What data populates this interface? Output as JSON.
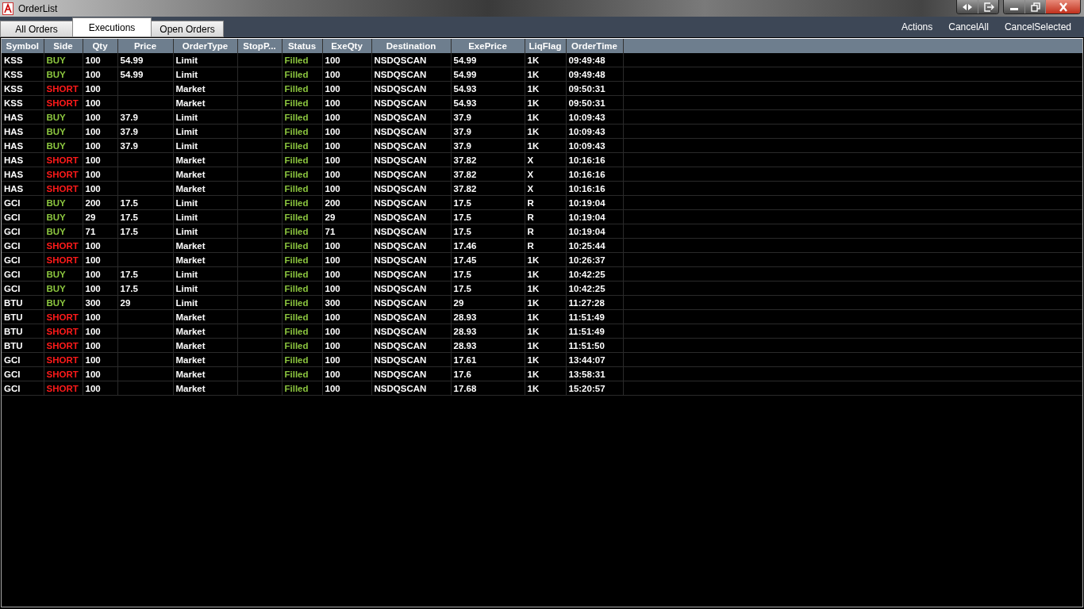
{
  "window": {
    "title": "OrderList"
  },
  "tabs": [
    {
      "label": "All Orders",
      "selected": false
    },
    {
      "label": "Executions",
      "selected": true
    },
    {
      "label": "Open Orders",
      "selected": false
    }
  ],
  "actions": [
    "Actions",
    "CancelAll",
    "CancelSelected"
  ],
  "table": {
    "columns": [
      "Symbol",
      "Side",
      "Qty",
      "Price",
      "OrderType",
      "StopP...",
      "Status",
      "ExeQty",
      "Destination",
      "ExePrice",
      "LiqFlag",
      "OrderTime"
    ],
    "rows": [
      {
        "symbol": "KSS",
        "side": {
          "text": "BUY",
          "color": "#8cc63f"
        },
        "qty": "100",
        "price": "54.99",
        "order_type": "Limit",
        "status": {
          "text": "Filled",
          "color": "#8cc63f"
        },
        "exe_qty": "100",
        "destination": "NSDQSCAN",
        "exe_price": "54.99",
        "liq_flag": "1K",
        "order_time": "09:49:48"
      },
      {
        "symbol": "KSS",
        "side": {
          "text": "BUY",
          "color": "#8cc63f"
        },
        "qty": "100",
        "price": "54.99",
        "order_type": "Limit",
        "status": {
          "text": "Filled",
          "color": "#8cc63f"
        },
        "exe_qty": "100",
        "destination": "NSDQSCAN",
        "exe_price": "54.99",
        "liq_flag": "1K",
        "order_time": "09:49:48"
      },
      {
        "symbol": "KSS",
        "side": {
          "text": "SHORT",
          "color": "#ff1a1a"
        },
        "qty": "100",
        "order_type": "Market",
        "status": {
          "text": "Filled",
          "color": "#8cc63f"
        },
        "exe_qty": "100",
        "destination": "NSDQSCAN",
        "exe_price": "54.93",
        "liq_flag": "1K",
        "order_time": "09:50:31"
      },
      {
        "symbol": "KSS",
        "side": {
          "text": "SHORT",
          "color": "#ff1a1a"
        },
        "qty": "100",
        "order_type": "Market",
        "status": {
          "text": "Filled",
          "color": "#8cc63f"
        },
        "exe_qty": "100",
        "destination": "NSDQSCAN",
        "exe_price": "54.93",
        "liq_flag": "1K",
        "order_time": "09:50:31"
      },
      {
        "symbol": "HAS",
        "side": {
          "text": "BUY",
          "color": "#8cc63f"
        },
        "qty": "100",
        "price": "37.9",
        "order_type": "Limit",
        "status": {
          "text": "Filled",
          "color": "#8cc63f"
        },
        "exe_qty": "100",
        "destination": "NSDQSCAN",
        "exe_price": "37.9",
        "liq_flag": "1K",
        "order_time": "10:09:43"
      },
      {
        "symbol": "HAS",
        "side": {
          "text": "BUY",
          "color": "#8cc63f"
        },
        "qty": "100",
        "price": "37.9",
        "order_type": "Limit",
        "status": {
          "text": "Filled",
          "color": "#8cc63f"
        },
        "exe_qty": "100",
        "destination": "NSDQSCAN",
        "exe_price": "37.9",
        "liq_flag": "1K",
        "order_time": "10:09:43"
      },
      {
        "symbol": "HAS",
        "side": {
          "text": "BUY",
          "color": "#8cc63f"
        },
        "qty": "100",
        "price": "37.9",
        "order_type": "Limit",
        "status": {
          "text": "Filled",
          "color": "#8cc63f"
        },
        "exe_qty": "100",
        "destination": "NSDQSCAN",
        "exe_price": "37.9",
        "liq_flag": "1K",
        "order_time": "10:09:43"
      },
      {
        "symbol": "HAS",
        "side": {
          "text": "SHORT",
          "color": "#ff1a1a"
        },
        "qty": "100",
        "order_type": "Market",
        "status": {
          "text": "Filled",
          "color": "#8cc63f"
        },
        "exe_qty": "100",
        "destination": "NSDQSCAN",
        "exe_price": "37.82",
        "liq_flag": "X",
        "order_time": "10:16:16"
      },
      {
        "symbol": "HAS",
        "side": {
          "text": "SHORT",
          "color": "#ff1a1a"
        },
        "qty": "100",
        "order_type": "Market",
        "status": {
          "text": "Filled",
          "color": "#8cc63f"
        },
        "exe_qty": "100",
        "destination": "NSDQSCAN",
        "exe_price": "37.82",
        "liq_flag": "X",
        "order_time": "10:16:16"
      },
      {
        "symbol": "HAS",
        "side": {
          "text": "SHORT",
          "color": "#ff1a1a"
        },
        "qty": "100",
        "order_type": "Market",
        "status": {
          "text": "Filled",
          "color": "#8cc63f"
        },
        "exe_qty": "100",
        "destination": "NSDQSCAN",
        "exe_price": "37.82",
        "liq_flag": "X",
        "order_time": "10:16:16"
      },
      {
        "symbol": "GCI",
        "side": {
          "text": "BUY",
          "color": "#8cc63f"
        },
        "qty": "200",
        "price": "17.5",
        "order_type": "Limit",
        "status": {
          "text": "Filled",
          "color": "#8cc63f"
        },
        "exe_qty": "200",
        "destination": "NSDQSCAN",
        "exe_price": "17.5",
        "liq_flag": "R",
        "order_time": "10:19:04"
      },
      {
        "symbol": "GCI",
        "side": {
          "text": "BUY",
          "color": "#8cc63f"
        },
        "qty": "29",
        "price": "17.5",
        "order_type": "Limit",
        "status": {
          "text": "Filled",
          "color": "#8cc63f"
        },
        "exe_qty": "29",
        "destination": "NSDQSCAN",
        "exe_price": "17.5",
        "liq_flag": "R",
        "order_time": "10:19:04"
      },
      {
        "symbol": "GCI",
        "side": {
          "text": "BUY",
          "color": "#8cc63f"
        },
        "qty": "71",
        "price": "17.5",
        "order_type": "Limit",
        "status": {
          "text": "Filled",
          "color": "#8cc63f"
        },
        "exe_qty": "71",
        "destination": "NSDQSCAN",
        "exe_price": "17.5",
        "liq_flag": "R",
        "order_time": "10:19:04"
      },
      {
        "symbol": "GCI",
        "side": {
          "text": "SHORT",
          "color": "#ff1a1a"
        },
        "qty": "100",
        "order_type": "Market",
        "status": {
          "text": "Filled",
          "color": "#8cc63f"
        },
        "exe_qty": "100",
        "destination": "NSDQSCAN",
        "exe_price": "17.46",
        "liq_flag": "R",
        "order_time": "10:25:44"
      },
      {
        "symbol": "GCI",
        "side": {
          "text": "SHORT",
          "color": "#ff1a1a"
        },
        "qty": "100",
        "order_type": "Market",
        "status": {
          "text": "Filled",
          "color": "#8cc63f"
        },
        "exe_qty": "100",
        "destination": "NSDQSCAN",
        "exe_price": "17.45",
        "liq_flag": "1K",
        "order_time": "10:26:37"
      },
      {
        "symbol": "GCI",
        "side": {
          "text": "BUY",
          "color": "#8cc63f"
        },
        "qty": "100",
        "price": "17.5",
        "order_type": "Limit",
        "status": {
          "text": "Filled",
          "color": "#8cc63f"
        },
        "exe_qty": "100",
        "destination": "NSDQSCAN",
        "exe_price": "17.5",
        "liq_flag": "1K",
        "order_time": "10:42:25"
      },
      {
        "symbol": "GCI",
        "side": {
          "text": "BUY",
          "color": "#8cc63f"
        },
        "qty": "100",
        "price": "17.5",
        "order_type": "Limit",
        "status": {
          "text": "Filled",
          "color": "#8cc63f"
        },
        "exe_qty": "100",
        "destination": "NSDQSCAN",
        "exe_price": "17.5",
        "liq_flag": "1K",
        "order_time": "10:42:25"
      },
      {
        "symbol": "BTU",
        "side": {
          "text": "BUY",
          "color": "#8cc63f"
        },
        "qty": "300",
        "price": "29",
        "order_type": "Limit",
        "status": {
          "text": "Filled",
          "color": "#8cc63f"
        },
        "exe_qty": "300",
        "destination": "NSDQSCAN",
        "exe_price": "29",
        "liq_flag": "1K",
        "order_time": "11:27:28"
      },
      {
        "symbol": "BTU",
        "side": {
          "text": "SHORT",
          "color": "#ff1a1a"
        },
        "qty": "100",
        "order_type": "Market",
        "status": {
          "text": "Filled",
          "color": "#8cc63f"
        },
        "exe_qty": "100",
        "destination": "NSDQSCAN",
        "exe_price": "28.93",
        "liq_flag": "1K",
        "order_time": "11:51:49"
      },
      {
        "symbol": "BTU",
        "side": {
          "text": "SHORT",
          "color": "#ff1a1a"
        },
        "qty": "100",
        "order_type": "Market",
        "status": {
          "text": "Filled",
          "color": "#8cc63f"
        },
        "exe_qty": "100",
        "destination": "NSDQSCAN",
        "exe_price": "28.93",
        "liq_flag": "1K",
        "order_time": "11:51:49"
      },
      {
        "symbol": "BTU",
        "side": {
          "text": "SHORT",
          "color": "#ff1a1a"
        },
        "qty": "100",
        "order_type": "Market",
        "status": {
          "text": "Filled",
          "color": "#8cc63f"
        },
        "exe_qty": "100",
        "destination": "NSDQSCAN",
        "exe_price": "28.93",
        "liq_flag": "1K",
        "order_time": "11:51:50"
      },
      {
        "symbol": "GCI",
        "side": {
          "text": "SHORT",
          "color": "#ff1a1a"
        },
        "qty": "100",
        "order_type": "Market",
        "status": {
          "text": "Filled",
          "color": "#8cc63f"
        },
        "exe_qty": "100",
        "destination": "NSDQSCAN",
        "exe_price": "17.61",
        "liq_flag": "1K",
        "order_time": "13:44:07"
      },
      {
        "symbol": "GCI",
        "side": {
          "text": "SHORT",
          "color": "#ff1a1a"
        },
        "qty": "100",
        "order_type": "Market",
        "status": {
          "text": "Filled",
          "color": "#8cc63f"
        },
        "exe_qty": "100",
        "destination": "NSDQSCAN",
        "exe_price": "17.6",
        "liq_flag": "1K",
        "order_time": "13:58:31"
      },
      {
        "symbol": "GCI",
        "side": {
          "text": "SHORT",
          "color": "#ff1a1a"
        },
        "qty": "100",
        "order_type": "Market",
        "status": {
          "text": "Filled",
          "color": "#8cc63f"
        },
        "exe_qty": "100",
        "destination": "NSDQSCAN",
        "exe_price": "17.68",
        "liq_flag": "1K",
        "order_time": "15:20:57"
      }
    ]
  }
}
